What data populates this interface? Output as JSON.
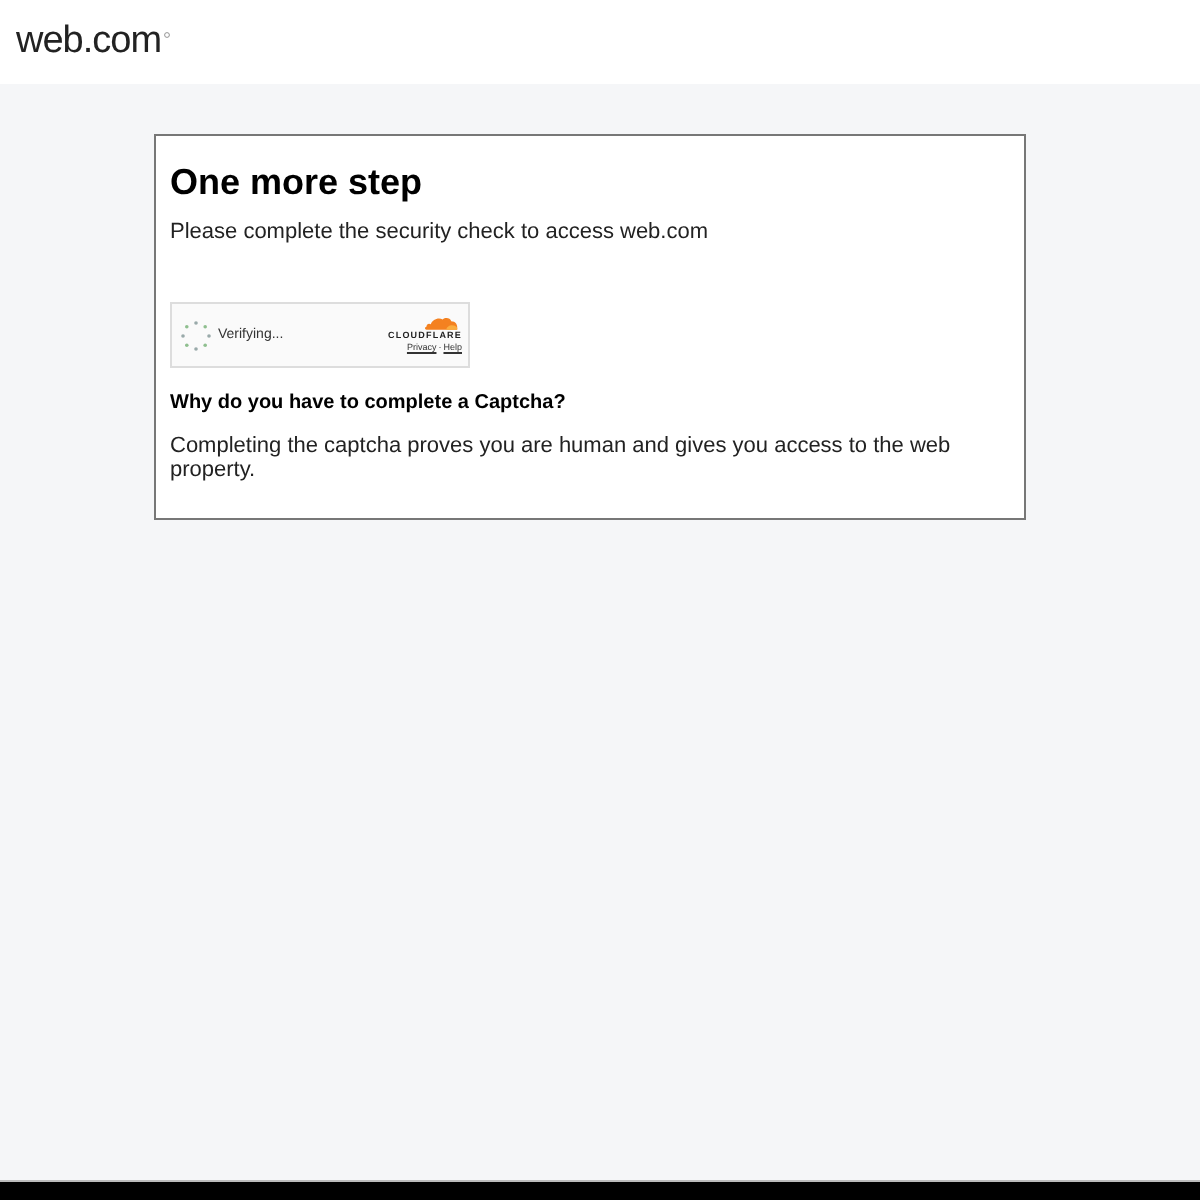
{
  "header": {
    "logo": "web.com"
  },
  "card": {
    "title": "One more step",
    "subtitle": "Please complete the security check to access web.com",
    "captcha": {
      "status": "Verifying...",
      "brand": "CLOUDFLARE",
      "links": [
        "Privacy",
        "Help"
      ],
      "separator": "·"
    },
    "question": "Why do you have to complete a Captcha?",
    "answer": "Completing the captcha proves you are human and gives you access to the web property."
  }
}
